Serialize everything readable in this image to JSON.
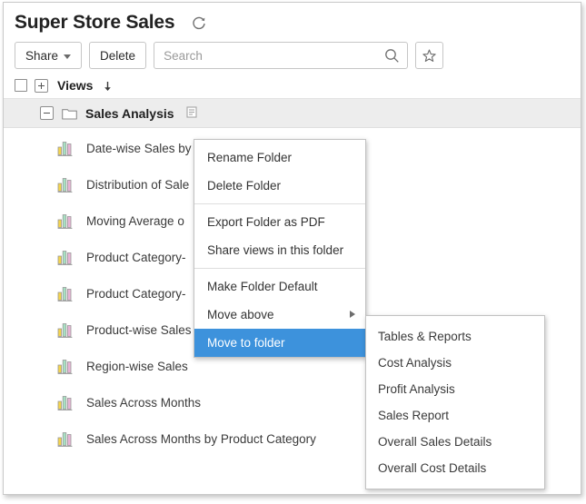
{
  "header": {
    "title": "Super Store Sales",
    "refresh_icon": "refresh-icon"
  },
  "toolbar": {
    "share_label": "Share",
    "delete_label": "Delete",
    "search_placeholder": "Search",
    "search_value": "",
    "search_icon": "search-icon",
    "favorite_icon": "star-icon"
  },
  "views_header": {
    "label": "Views",
    "checkbox_icon": "checkbox-icon",
    "expand_icon": "plus-box-icon",
    "sort_icon": "sort-down-arrow-icon"
  },
  "folder": {
    "name": "Sales Analysis",
    "collapse_icon": "minus-box-icon",
    "folder_icon": "folder-icon",
    "menu_icon": "list-menu-icon"
  },
  "views": [
    {
      "name": "Date-wise Sales by",
      "icon": "bar-chart-icon"
    },
    {
      "name": "Distribution of Sale",
      "icon": "bar-chart-icon"
    },
    {
      "name": "Moving Average o",
      "icon": "bar-chart-icon"
    },
    {
      "name": "Product Category-",
      "icon": "bar-chart-icon"
    },
    {
      "name": "Product Category-",
      "icon": "bar-chart-icon"
    },
    {
      "name": "Product-wise Sales",
      "icon": "bar-chart-icon"
    },
    {
      "name": "Region-wise Sales",
      "icon": "bar-chart-icon"
    },
    {
      "name": "Sales Across Months",
      "icon": "bar-chart-icon"
    },
    {
      "name": "Sales Across Months by Product Category",
      "icon": "bar-chart-icon"
    }
  ],
  "context_menu": {
    "items": [
      {
        "label": "Rename Folder",
        "selected": false,
        "has_submenu": false
      },
      {
        "label": "Delete Folder",
        "selected": false,
        "has_submenu": false
      },
      {
        "label": "Export Folder as PDF",
        "selected": false,
        "has_submenu": false
      },
      {
        "label": "Share views in this folder",
        "selected": false,
        "has_submenu": false
      },
      {
        "label": "Make Folder Default",
        "selected": false,
        "has_submenu": false
      },
      {
        "label": "Move above",
        "selected": false,
        "has_submenu": true
      },
      {
        "label": "Move to folder",
        "selected": true,
        "has_submenu": true
      }
    ]
  },
  "submenu": {
    "items": [
      {
        "label": "Tables & Reports"
      },
      {
        "label": "Cost Analysis"
      },
      {
        "label": "Profit Analysis"
      },
      {
        "label": "Sales Report"
      },
      {
        "label": "Overall Sales Details"
      },
      {
        "label": "Overall Cost Details"
      }
    ]
  },
  "colors": {
    "highlight": "#3d92dc",
    "row_highlight": "#ededed",
    "bar_yellow": "#f5d44b",
    "bar_green": "#a8e0c2",
    "bar_pink": "#e9b4d6",
    "text": "#3a3a3a"
  }
}
